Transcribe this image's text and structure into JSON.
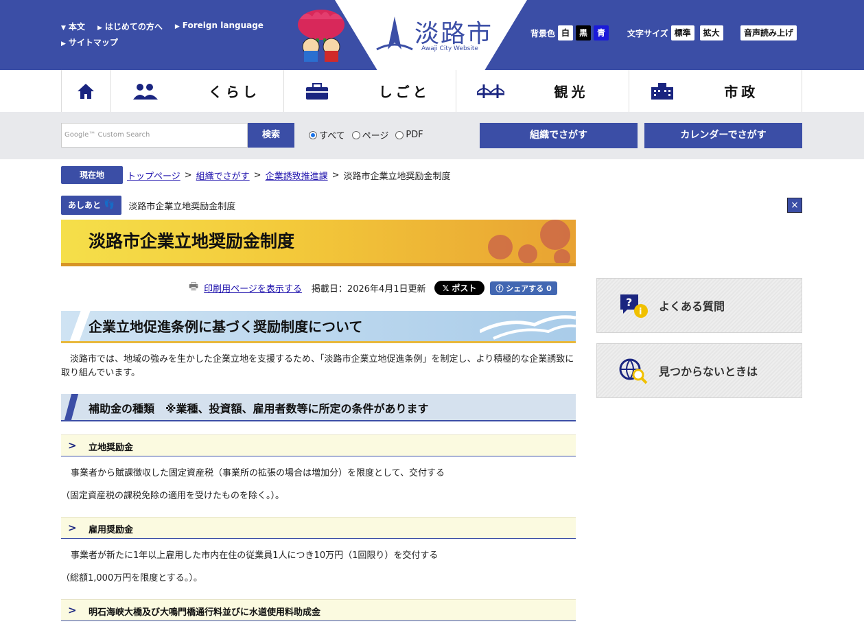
{
  "header": {
    "links": [
      "本文",
      "はじめての方へ",
      "Foreign language",
      "サイトマップ"
    ],
    "logo_title": "淡路市",
    "logo_sub": "Awaji City Website",
    "bg_label": "背景色",
    "bg_options": [
      "白",
      "黒",
      "青"
    ],
    "font_label": "文字サイズ",
    "font_options": [
      "標準",
      "拡大"
    ],
    "read_aloud": "音声読み上げ"
  },
  "nav": {
    "items": [
      {
        "label": "くらし",
        "icon": "people-icon"
      },
      {
        "label": "しごと",
        "icon": "briefcase-icon"
      },
      {
        "label": "観光",
        "icon": "bridge-icon"
      },
      {
        "label": "市政",
        "icon": "building-icon"
      }
    ]
  },
  "search": {
    "placeholder": "Google™ Custom Search",
    "button": "検索",
    "radio_all": "すべて",
    "radio_page": "ページ",
    "radio_pdf": "PDF",
    "org_button": "組織でさがす",
    "calendar_button": "カレンダーでさがす"
  },
  "breadcrumb": {
    "label": "現在地",
    "items": [
      "トップページ",
      "組織でさがす",
      "企業誘致推進課"
    ],
    "current": "淡路市企業立地奨励金制度",
    "sep": ">"
  },
  "ashiato": {
    "label": "あしあと",
    "item": "淡路市企業立地奨励金制度",
    "close": "×"
  },
  "page": {
    "title": "淡路市企業立地奨励金制度",
    "print_link": "印刷用ページを表示する",
    "date": "掲載日：2026年4月1日更新",
    "x_post": "ポスト",
    "fb_share": "シェアする 0",
    "h2": "企業立地促進条例に基づく奨励制度について",
    "intro": "淡路市では、地域の強みを生かした企業立地を支援するため、「淡路市企業立地促進条例」を制定し、より積極的な企業誘致に取り組んでいます。",
    "h3": "補助金の種類　※業種、投資額、雇用者数等に所定の条件があります",
    "sections": [
      {
        "title": "立地奨励金",
        "line1": "事業者から賦課徴収した固定資産税（事業所の拡張の場合は増加分）を限度として、交付する",
        "line2": "（固定資産税の課税免除の適用を受けたものを除く。）。"
      },
      {
        "title": "雇用奨励金",
        "line1": "事業者が新たに1年以上雇用した市内在住の従業員1人につき10万円（1回限り）を交付する",
        "line2": "（総額1,000万円を限度とする。）。"
      },
      {
        "title": "明石海峡大橋及び大鳴門橋通行料並びに水道使用料助成金"
      }
    ]
  },
  "sidebar": {
    "faq": "よくある質問",
    "notfound": "見つからないときは"
  }
}
